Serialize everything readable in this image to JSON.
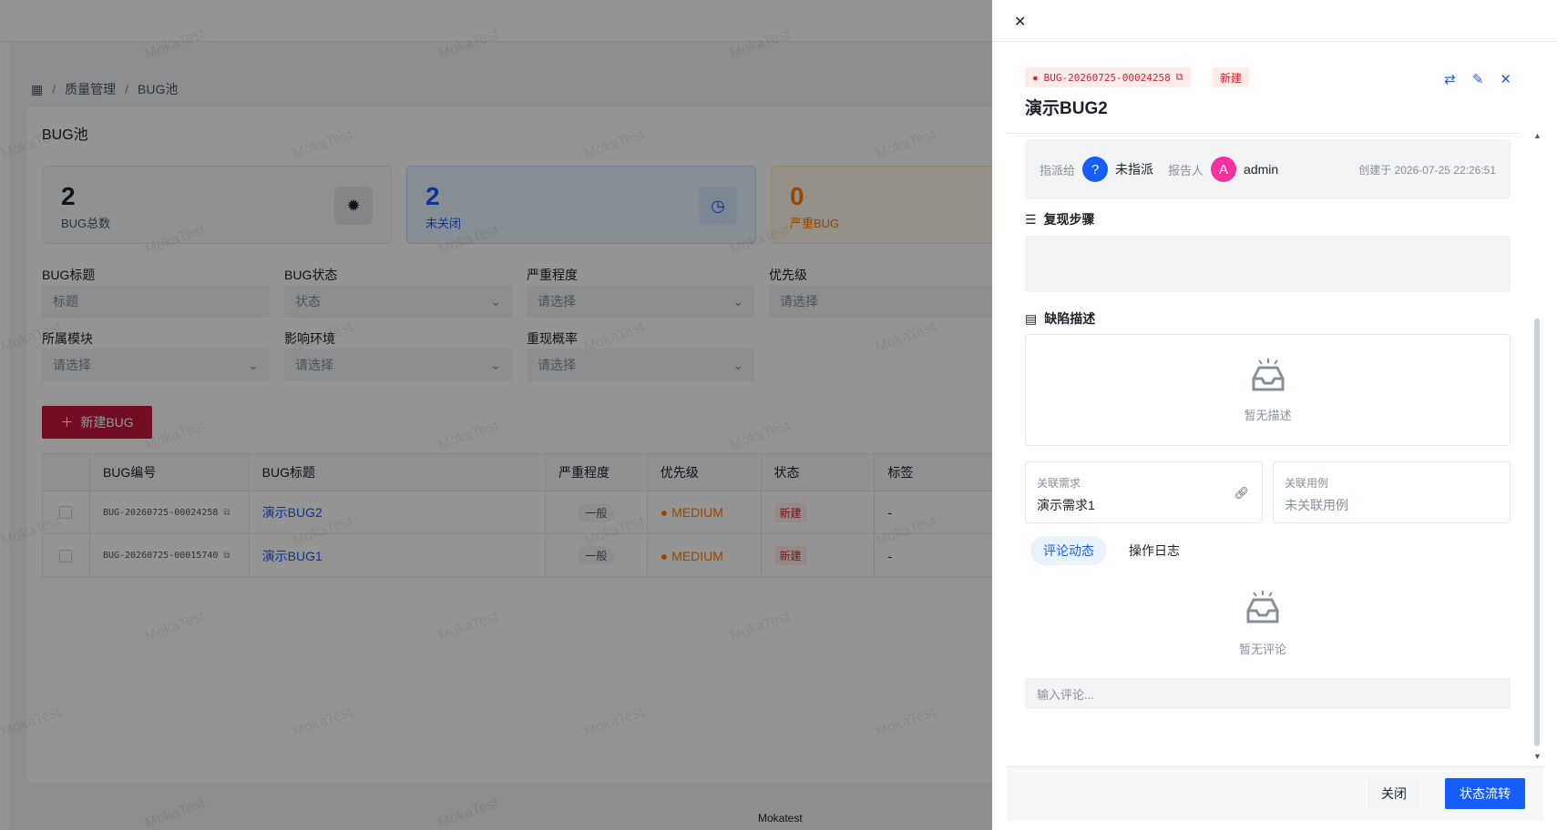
{
  "breadcrumb": {
    "items": [
      "质量管理",
      "BUG池"
    ]
  },
  "page": {
    "title": "BUG池"
  },
  "stats": [
    {
      "value": "2",
      "label": "BUG总数",
      "icon": "bug-icon",
      "color": "#1d2129"
    },
    {
      "value": "2",
      "label": "未关闭",
      "icon": "clock-icon",
      "color": "#165dff"
    },
    {
      "value": "0",
      "label": "严重BUG",
      "icon": "warning-icon",
      "color": "#ff7d00"
    }
  ],
  "filters": {
    "title": {
      "label": "BUG标题",
      "placeholder": "标题"
    },
    "status": {
      "label": "BUG状态",
      "placeholder": "状态"
    },
    "severity": {
      "label": "严重程度",
      "placeholder": "请选择"
    },
    "priority": {
      "label": "优先级",
      "placeholder": "请选择"
    },
    "module": {
      "label": "所属模块",
      "placeholder": "请选择"
    },
    "env": {
      "label": "影响环境",
      "placeholder": "请选择"
    },
    "repro": {
      "label": "重现概率",
      "placeholder": "请选择"
    }
  },
  "new_button": "新建BUG",
  "table": {
    "headers": [
      "BUG编号",
      "BUG标题",
      "严重程度",
      "优先级",
      "状态",
      "标签"
    ],
    "rows": [
      {
        "id": "BUG-20260725-00024258",
        "title": "演示BUG2",
        "severity": "一般",
        "priority": "MEDIUM",
        "status": "新建",
        "tags": "-"
      },
      {
        "id": "BUG-20260725-00015740",
        "title": "演示BUG1",
        "severity": "一般",
        "priority": "MEDIUM",
        "status": "新建",
        "tags": "-"
      }
    ]
  },
  "watermark": "MokaTest",
  "footer": "Mokatest",
  "drawer": {
    "bug_id": "BUG-20260725-00024258",
    "status_badge": "新建",
    "title": "演示BUG2",
    "assign_label": "指派给",
    "assignee": "未指派",
    "assignee_avatar": "?",
    "reporter_label": "报告人",
    "reporter": "admin",
    "reporter_avatar": "A",
    "created": "创建于 2026-07-25 22:26:51",
    "steps_heading": "复现步骤",
    "desc_heading": "缺陷描述",
    "desc_empty": "暂无描述",
    "linked_req_label": "关联需求",
    "linked_req": "演示需求1",
    "linked_case_label": "关联用例",
    "linked_case": "未关联用例",
    "tabs": [
      "评论动态",
      "操作日志"
    ],
    "comments_empty": "暂无评论",
    "comment_placeholder": "输入评论...",
    "close_button": "关闭",
    "flow_button": "状态流转"
  }
}
